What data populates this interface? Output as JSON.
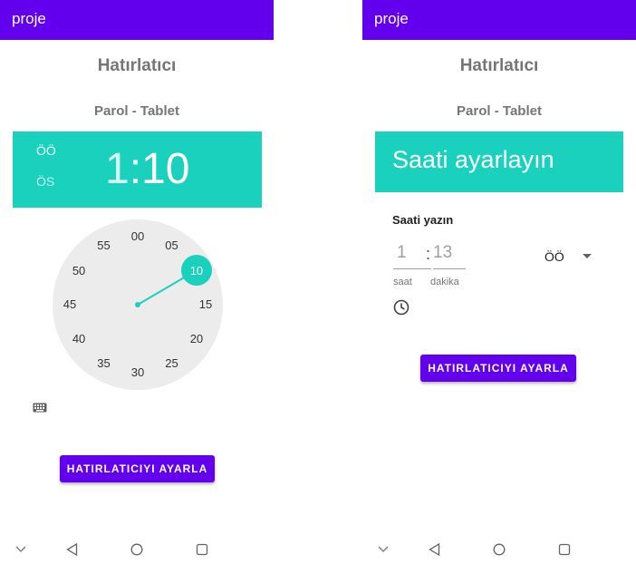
{
  "app_title": "proje",
  "title": "Hatırlatıcı",
  "subtitle": "Parol - Tablet",
  "picker_clock": {
    "am_label": "ÖÖ",
    "pm_label": "ÖS",
    "hour": "1",
    "separator": ":",
    "minute": "10",
    "dial_numbers": [
      "00",
      "05",
      "10",
      "15",
      "20",
      "25",
      "30",
      "35",
      "40",
      "45",
      "50",
      "55"
    ],
    "selected_minute": "10"
  },
  "picker_input": {
    "header_title": "Saati ayarlayın",
    "prompt": "Saati yazın",
    "hour_value": "1",
    "separator": ":",
    "minute_value": "13",
    "hour_label": "saat",
    "minute_label": "dakika",
    "ampm_value": "ÖÖ"
  },
  "button_label": "HATIRLATICIYI AYARLA",
  "colors": {
    "appbar": "#6200ee",
    "header": "#1ad1bd",
    "button": "#6200ee"
  },
  "icons": [
    "keyboard-icon",
    "clock-icon",
    "dropdown-arrow-icon",
    "nav-chevron-down-icon",
    "nav-back-icon",
    "nav-home-icon",
    "nav-recents-icon"
  ]
}
